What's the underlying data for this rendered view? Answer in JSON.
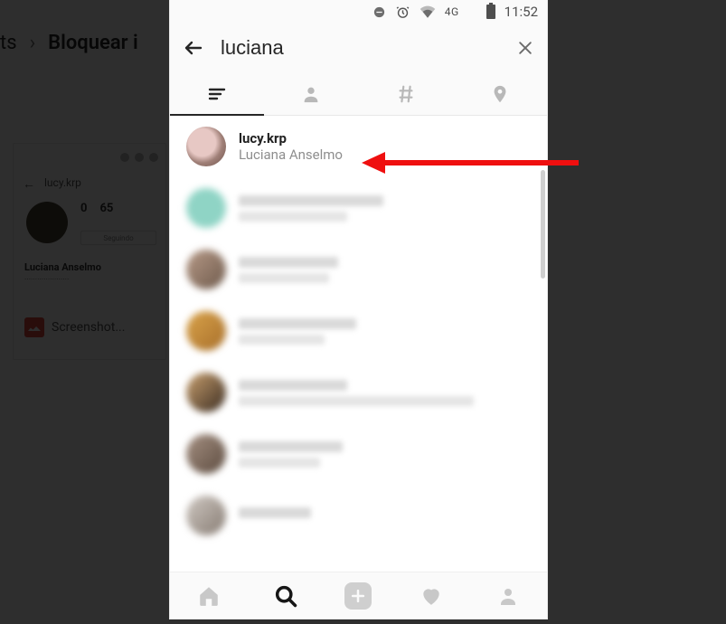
{
  "background": {
    "breadcrumb_prev_fragment": "ts",
    "breadcrumb_current": "Bloquear i",
    "card_username": "lucy.krp",
    "card_stat1": "0",
    "card_stat2": "65",
    "card_follow": "Seguindo",
    "card_fullname": "Luciana Anselmo",
    "screenshot_label": "Screenshot..."
  },
  "statusbar": {
    "network": "4G",
    "time": "11:52"
  },
  "search": {
    "query": "luciana"
  },
  "tabs": {
    "top": "top",
    "people": "people",
    "tags": "tags",
    "places": "places"
  },
  "results": [
    {
      "username": "lucy.krp",
      "fullname": "Luciana Anselmo"
    }
  ],
  "nav": {
    "home": "home",
    "search": "search",
    "add": "add",
    "activity": "activity",
    "profile": "profile"
  }
}
